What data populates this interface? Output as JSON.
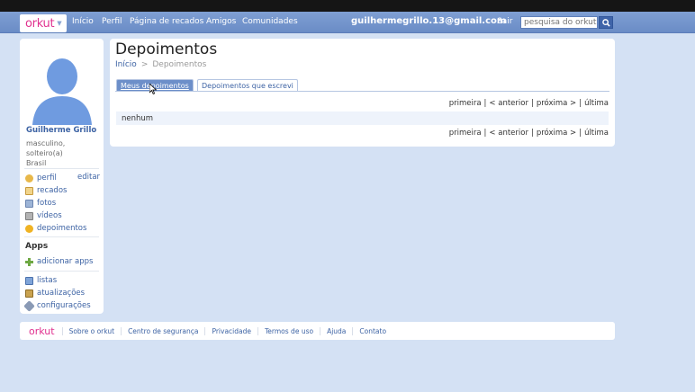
{
  "nav": {
    "logo": "orkut",
    "links": [
      "Início",
      "Perfil",
      "Página de recados",
      "Amigos",
      "Comunidades"
    ],
    "user_email": "guilhermegrillo.13@gmail.com",
    "signout": "Sair",
    "search_placeholder": "pesquisa do orkut"
  },
  "sidebar": {
    "name": "Guilherme Grillo",
    "info": [
      "masculino,",
      "solteiro(a)",
      "Brasil"
    ],
    "edit_label": "editar",
    "items": [
      {
        "label": "perfil",
        "icon": "profile-icon"
      },
      {
        "label": "recados",
        "icon": "scraps-icon"
      },
      {
        "label": "fotos",
        "icon": "photos-icon"
      },
      {
        "label": "vídeos",
        "icon": "videos-icon"
      },
      {
        "label": "depoimentos",
        "icon": "testimonials-icon"
      }
    ],
    "apps_heading": "Apps",
    "add_apps": "adicionar apps",
    "extra_items": [
      {
        "label": "listas",
        "icon": "lists-icon"
      },
      {
        "label": "atualizações",
        "icon": "updates-icon"
      },
      {
        "label": "configurações",
        "icon": "settings-icon"
      }
    ]
  },
  "main": {
    "title": "Depoimentos",
    "breadcrumb": {
      "home": "Início",
      "separator": ">",
      "current": "Depoimentos"
    },
    "tabs": [
      {
        "label": "Meus depoimentos",
        "active": true
      },
      {
        "label": "Depoimentos que escrevi",
        "active": false
      }
    ],
    "pager": {
      "first": "primeira",
      "prev": "< anterior",
      "next": "próxima >",
      "last": "última",
      "separator": "|"
    },
    "empty_text": "nenhum"
  },
  "footer": {
    "logo": "orkut",
    "links": [
      "Sobre o orkut",
      "Centro de segurança",
      "Privacidade",
      "Termos de uso",
      "Ajuda",
      "Contato"
    ]
  },
  "colors": {
    "nav_bg": "#7395cc",
    "link": "#3d63a4",
    "logo_pink": "#e0318f",
    "page_bg": "#d4e1f4"
  }
}
